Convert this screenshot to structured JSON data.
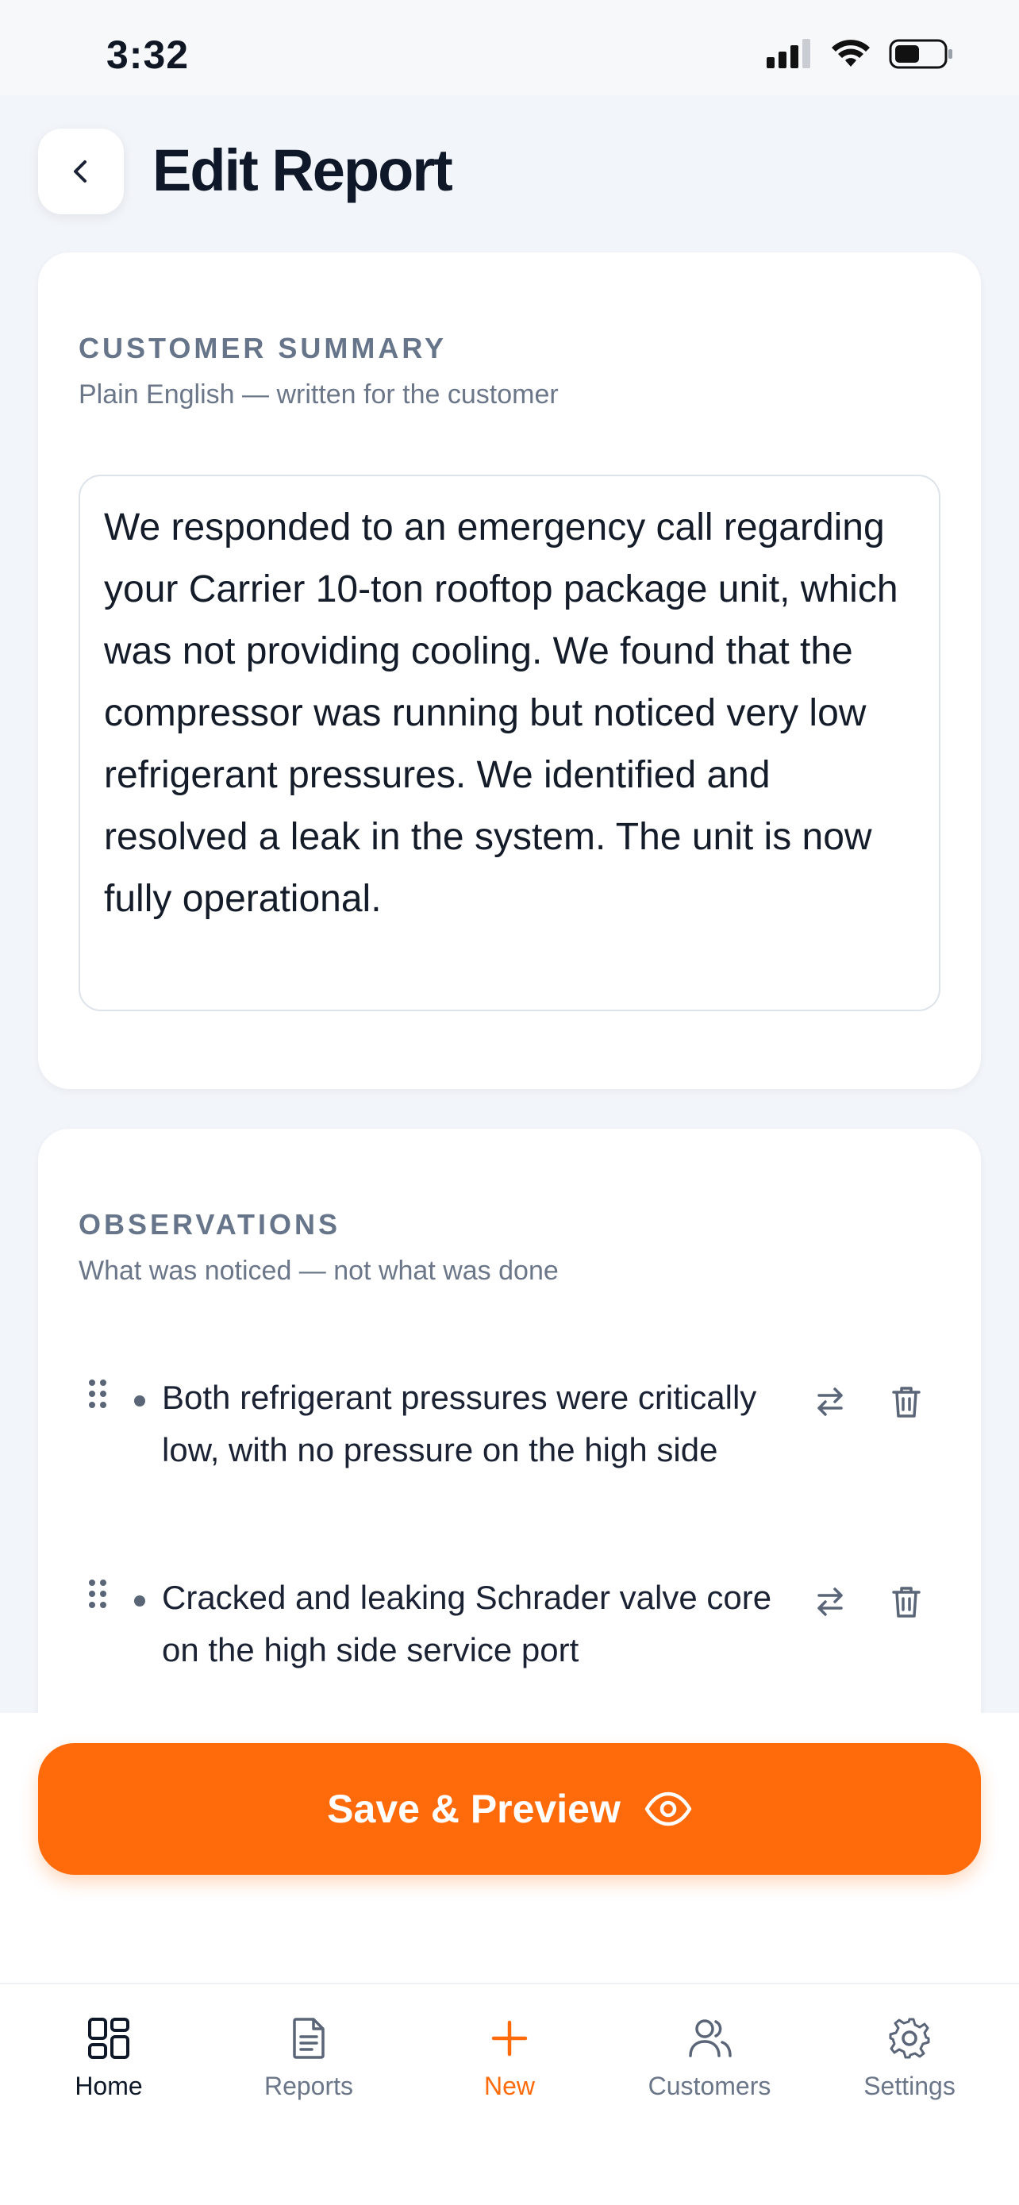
{
  "status_bar": {
    "time": "3:32"
  },
  "header": {
    "title": "Edit Report"
  },
  "customer_summary": {
    "title": "CUSTOMER SUMMARY",
    "subtitle": "Plain English — written for the customer",
    "text": "We responded to an emergency call regarding your Carrier 10-ton rooftop package unit, which was not providing cooling. We found that the compressor was running but noticed very low refrigerant pressures. We identified and resolved a leak in the system. The unit is now fully operational."
  },
  "observations": {
    "title": "OBSERVATIONS",
    "subtitle": "What was noticed — not what was done",
    "items": [
      {
        "text": "Both refrigerant pressures were critically low, with no pressure on the high side"
      },
      {
        "text": "Cracked and leaking Schrader valve core on the high side service port"
      }
    ]
  },
  "actions": {
    "save_label": "Save & Preview"
  },
  "tabbar": {
    "items": [
      {
        "label": "Home",
        "icon": "grid-icon"
      },
      {
        "label": "Reports",
        "icon": "document-icon"
      },
      {
        "label": "New",
        "icon": "plus-icon"
      },
      {
        "label": "Customers",
        "icon": "users-icon"
      },
      {
        "label": "Settings",
        "icon": "gear-icon"
      }
    ],
    "active": "Home"
  },
  "colors": {
    "accent": "#ff6a0a",
    "background": "#f2f5f9",
    "muted": "#6b7789"
  }
}
